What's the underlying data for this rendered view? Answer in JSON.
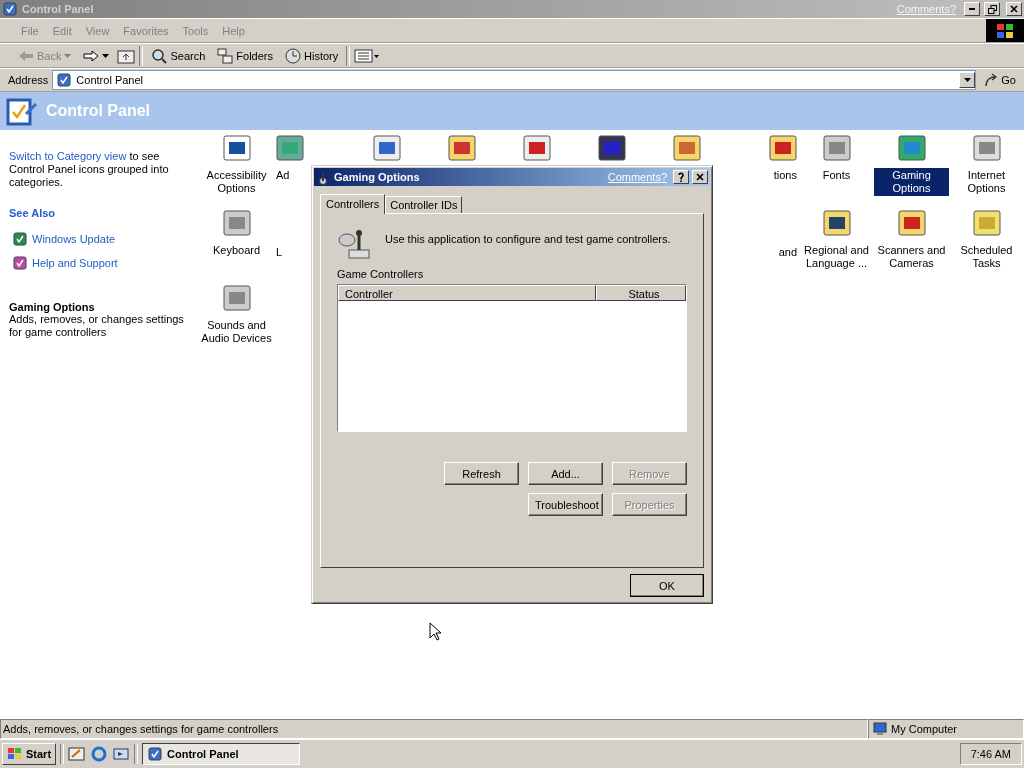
{
  "window": {
    "title": "Control Panel",
    "comments": "Comments?",
    "active": false
  },
  "menu": [
    {
      "label": "File"
    },
    {
      "label": "Edit"
    },
    {
      "label": "View"
    },
    {
      "label": "Favorites"
    },
    {
      "label": "Tools"
    },
    {
      "label": "Help"
    }
  ],
  "toolbar": {
    "back": "Back",
    "back_disabled": true,
    "search": "Search",
    "folders": "Folders",
    "history": "History"
  },
  "address": {
    "label": "Address",
    "value": "Control Panel",
    "go": "Go"
  },
  "header": {
    "title": "Control Panel"
  },
  "sidebar": {
    "switch_link": "Switch to Category view",
    "switch_text": " to see Control Panel icons grouped into categories.",
    "see_also": "See Also",
    "links": [
      {
        "label": "Windows Update"
      },
      {
        "label": "Help and Support"
      }
    ],
    "details_title": "Gaming Options",
    "details_text": "Adds, removes, or changes settings for game controllers"
  },
  "grid": [
    [
      {
        "kind": "full",
        "label": "Accessibility Options",
        "selected": false
      },
      {
        "kind": "cut_left",
        "label": "Ad",
        "selected": false
      },
      {
        "kind": "icon",
        "selected": false
      },
      {
        "kind": "icon",
        "selected": false
      },
      {
        "kind": "icon",
        "selected": false
      },
      {
        "kind": "icon",
        "selected": false
      },
      {
        "kind": "icon",
        "selected": false
      },
      {
        "kind": "cut_right",
        "label": "tions",
        "selected": false
      },
      {
        "kind": "full",
        "label": "Fonts",
        "selected": false
      },
      {
        "kind": "full",
        "label": "Gaming Options",
        "selected": true
      },
      {
        "kind": "full",
        "label": "Internet Options",
        "selected": false
      }
    ],
    [
      {
        "kind": "full",
        "label": "Keyboard",
        "selected": false
      },
      {
        "kind": "label_left",
        "label": "L",
        "selected": false
      },
      {
        "kind": "none"
      },
      {
        "kind": "none"
      },
      {
        "kind": "none"
      },
      {
        "kind": "none"
      },
      {
        "kind": "none"
      },
      {
        "kind": "label_right",
        "label": "and",
        "selected": false
      },
      {
        "kind": "full",
        "label": "Regional and Language ...",
        "selected": false
      },
      {
        "kind": "full",
        "label": "Scanners and Cameras",
        "selected": false
      },
      {
        "kind": "full",
        "label": "Scheduled Tasks",
        "selected": false
      }
    ],
    [
      {
        "kind": "full",
        "label": "Sounds and Audio Devices",
        "selected": false
      }
    ]
  ],
  "dialog": {
    "title": "Gaming Options",
    "comments": "Comments?",
    "tabs": [
      {
        "label": "Controllers",
        "selected": true
      },
      {
        "label": "Controller IDs",
        "selected": false
      }
    ],
    "intro": "Use this application to configure and test game controllers.",
    "list_label": "Game Controllers",
    "columns": [
      "Controller",
      "Status"
    ],
    "buttons": [
      {
        "label": "Refresh",
        "disabled": false
      },
      {
        "label": "Add...",
        "disabled": false
      },
      {
        "label": "Remove",
        "disabled": true
      },
      {
        "label": "Troubleshoot",
        "disabled": false
      },
      {
        "label": "Properties",
        "disabled": true
      }
    ],
    "ok": "OK"
  },
  "status_bar": {
    "text": "Adds, removes, or changes settings for game controllers",
    "zone": "My Computer"
  },
  "taskbar": {
    "start": "Start",
    "tasks": [
      {
        "label": "Control Panel",
        "selected": true
      }
    ],
    "clock": "7:46 AM"
  }
}
